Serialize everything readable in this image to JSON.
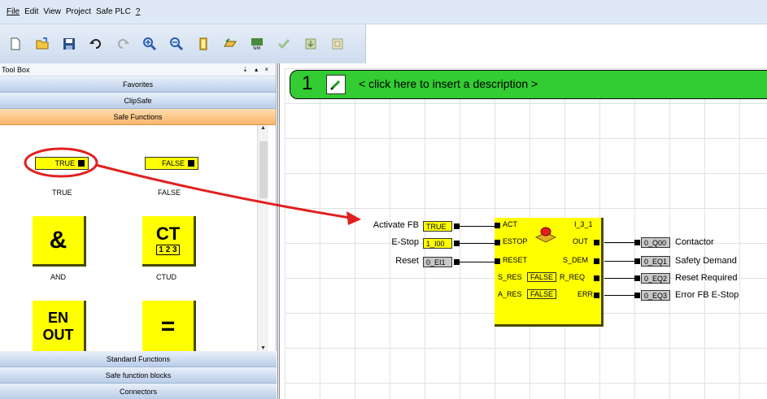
{
  "menu": [
    "File",
    "Edit",
    "View",
    "Project",
    "Safe PLC",
    "?"
  ],
  "toolbar": {
    "icons": [
      "new-file-icon",
      "open-folder-icon",
      "save-icon",
      "undo-icon",
      "redo-icon",
      "zoom-in-icon",
      "zoom-out-icon",
      "library-icon",
      "compile-icon",
      "simulate-icon",
      "check-icon",
      "download-icon",
      "fit-icon"
    ],
    "sim_label": "SIM"
  },
  "toolbox": {
    "title": "Tool Box",
    "controls": "⇣ ▴ ×",
    "categories_top": [
      "Favorites",
      "ClipSafe",
      "Safe Functions"
    ],
    "categories_bottom": [
      "Standard Functions",
      "Safe function blocks",
      "Connectors"
    ],
    "palette": {
      "true_box": "TRUE",
      "false_box": "FALSE",
      "true_label": "TRUE",
      "false_label": "FALSE",
      "and_symbol": "&",
      "and_label": "AND",
      "ctud_symbol": "CT",
      "ctud_digits": "1 2 3",
      "ctud_label": "CTUD",
      "en_symbol": "EN",
      "out_symbol": "OUT",
      "eq_symbol": "="
    }
  },
  "network": {
    "number": "1",
    "description": "< click here to insert a description >"
  },
  "inputs": [
    {
      "label": "Activate FB",
      "var": "TRUE"
    },
    {
      "label": "E-Stop",
      "var": "1_I00"
    },
    {
      "label": "Reset",
      "var": "0_EI1"
    }
  ],
  "function_block": {
    "instance": "I_3_1",
    "in_ports": [
      "ACT",
      "ESTOP",
      "RESET",
      "S_RES",
      "A_RES"
    ],
    "in_consts": {
      "S_RES": "FALSE",
      "A_RES": "FALSE"
    },
    "out_ports": [
      "OUT",
      "S_DEM",
      "R_REQ",
      "ERR"
    ]
  },
  "outputs": [
    {
      "var": "0_Q00",
      "label": "Contactor"
    },
    {
      "var": "0_EQ1",
      "label": "Safety Demand"
    },
    {
      "var": "0_EQ2",
      "label": "Reset Required"
    },
    {
      "var": "0_EQ3",
      "label": "Error FB E-Stop"
    }
  ],
  "colors": {
    "block_yellow": "#ffff00",
    "network_green": "#33cc33",
    "annotation_red": "#e02020",
    "active_category": "#f8b66c"
  }
}
